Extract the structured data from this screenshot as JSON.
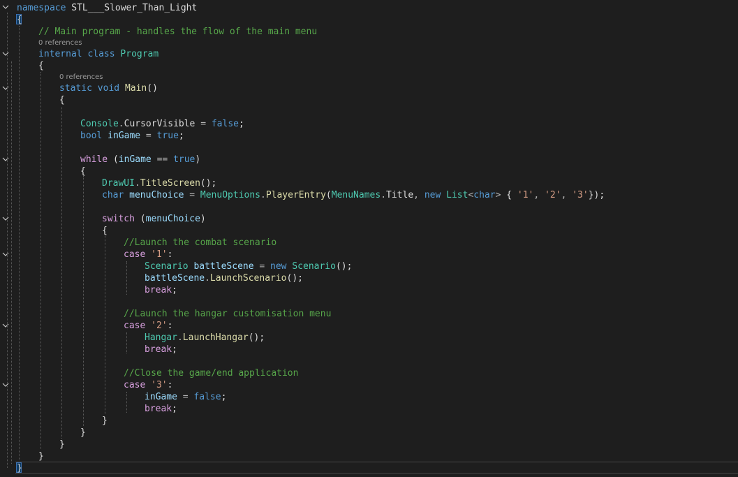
{
  "code_editor": {
    "codelens": [
      "0 references",
      "0 references"
    ],
    "lines": {
      "l1": {
        "kw_namespace": "namespace",
        "ns_name": "STL___Slower_Than_Light"
      },
      "l2": {
        "brace": "{"
      },
      "l3": {
        "comment": "// Main program - handles the flow of the main menu"
      },
      "l4": {
        "kw_internal": "internal",
        "kw_class": "class",
        "class_name": "Program"
      },
      "l5": {
        "brace": "{"
      },
      "l6": {
        "kw_static": "static",
        "kw_void": "void",
        "method": "Main",
        "parens": "()"
      },
      "l7": {
        "brace": "{"
      },
      "l8": {
        "type": "Console",
        "dot": ".",
        "member": "CursorVisible",
        "eq": " = ",
        "value": "false",
        "semi": ";"
      },
      "l9": {
        "kw_bool": "bool",
        "var": "inGame",
        "eq": " = ",
        "value": "true",
        "semi": ";"
      },
      "l10": {
        "kw_while": "while",
        "open": " (",
        "var": "inGame",
        "op": " == ",
        "value": "true",
        "close": ")"
      },
      "l11": {
        "brace": "{"
      },
      "l12": {
        "type": "DrawUI",
        "dot": ".",
        "method": "TitleScreen",
        "tail": "();"
      },
      "l13": {
        "kw_char": "char",
        "var": "menuChoice",
        "eq": " = ",
        "type": "MenuOptions",
        "dot1": ".",
        "method": "PlayerEntry",
        "open": "(",
        "type2": "MenuNames",
        "dot2": ".",
        "member": "Title",
        "comma": ", ",
        "kw_new": "new",
        "list_type": "List",
        "lt": "<",
        "kw_char2": "char",
        "gt": ">",
        "init_open": " { ",
        "c1": "'1'",
        "sep1": ", ",
        "c2": "'2'",
        "sep2": ", ",
        "c3": "'3'",
        "end": "});"
      },
      "l14": {
        "kw_switch": "switch",
        "open": " (",
        "var": "menuChoice",
        "close": ")"
      },
      "l15": {
        "brace": "{"
      },
      "l16": {
        "comment": "//Launch the combat scenario"
      },
      "l17": {
        "kw_case": "case",
        "value": "'1'",
        "colon": ":"
      },
      "l18": {
        "type": "Scenario",
        "var": "battleScene",
        "eq": " = ",
        "kw_new": "new",
        "type2": "Scenario",
        "tail": "();"
      },
      "l19": {
        "var": "battleScene",
        "dot": ".",
        "method": "LaunchScenario",
        "tail": "();"
      },
      "l20": {
        "kw_break": "break",
        "semi": ";"
      },
      "l21": {
        "comment": "//Launch the hangar customisation menu"
      },
      "l22": {
        "kw_case": "case",
        "value": "'2'",
        "colon": ":"
      },
      "l23": {
        "type": "Hangar",
        "dot": ".",
        "method": "LaunchHangar",
        "tail": "();"
      },
      "l24": {
        "kw_break": "break",
        "semi": ";"
      },
      "l25": {
        "comment": "//Close the game/end application"
      },
      "l26": {
        "kw_case": "case",
        "value": "'3'",
        "colon": ":"
      },
      "l27": {
        "var": "inGame",
        "eq": " = ",
        "value": "false",
        "semi": ";"
      },
      "l28": {
        "kw_break": "break",
        "semi": ";"
      },
      "l29": {
        "brace": "}"
      },
      "l30": {
        "brace": "}"
      },
      "l31": {
        "brace": "}"
      },
      "l32": {
        "brace": "}"
      },
      "l33": {
        "brace": "}"
      }
    },
    "colors": {
      "background": "#1e1e1e",
      "keyword": "#569cd6",
      "control_keyword": "#d8a0df",
      "type": "#4ec9b0",
      "method": "#dcdcaa",
      "variable": "#9cdcfe",
      "string": "#d69d85",
      "comment": "#57a64a",
      "codelens": "#999999"
    },
    "icons": [
      "fold-chevron-icon"
    ]
  }
}
